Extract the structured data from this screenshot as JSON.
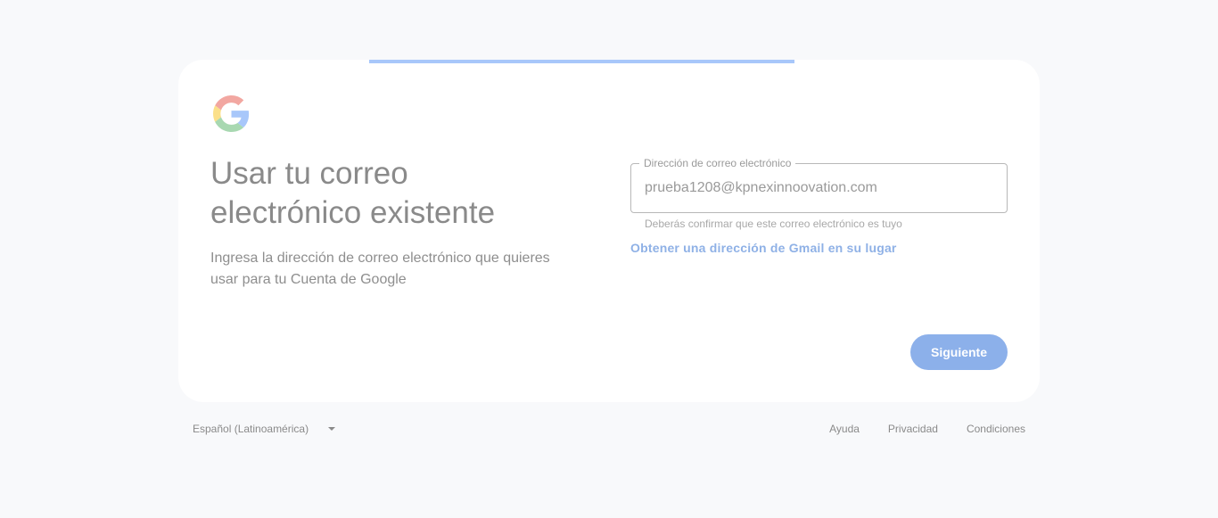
{
  "progress": {
    "fraction": 0.49
  },
  "logo": {
    "icon": "google-g-icon",
    "colors": {
      "blue": "#a8c7fa",
      "red": "#f2a7a1",
      "yellow": "#fbe08a",
      "green": "#a8d8b1"
    }
  },
  "heading": {
    "title": "Usar tu correo electrónico existente",
    "subtitle": "Ingresa la dirección de correo electrónico que quieres usar para tu Cuenta de Google"
  },
  "email_field": {
    "label": "Dirección de correo electrónico",
    "value": "prueba1208@kpnexinnoovation.com",
    "hint": "Deberás confirmar que este correo electrónico es tuyo"
  },
  "gmail_link": "Obtener una dirección de Gmail en su lugar",
  "next_button": "Siguiente",
  "footer": {
    "language": "Español (Latinoamérica)",
    "links": [
      "Ayuda",
      "Privacidad",
      "Condiciones"
    ]
  },
  "colors": {
    "accent": "#8cb0ea",
    "link": "#8fb1e6",
    "background": "#f8f9fb",
    "card": "#ffffff"
  }
}
